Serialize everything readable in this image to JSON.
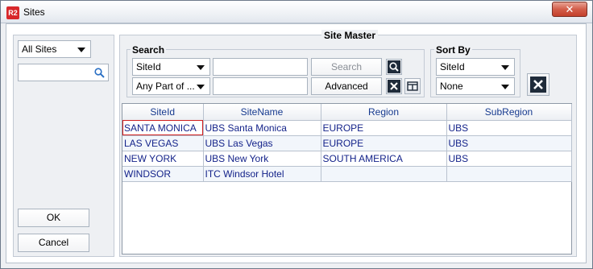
{
  "window": {
    "app_icon": "R2",
    "title": "Sites",
    "close_glyph": "✕"
  },
  "left": {
    "site_filter": "All Sites",
    "search_placeholder": "",
    "ok_label": "OK",
    "cancel_label": "Cancel"
  },
  "main": {
    "title": "Site Master",
    "search": {
      "group_label": "Search",
      "field_select": "SiteId",
      "field_value": "",
      "match_select": "Any Part of ...",
      "match_value": "",
      "search_label": "Search",
      "advanced_label": "Advanced"
    },
    "sort": {
      "group_label": "Sort By",
      "primary": "SiteId",
      "secondary": "None"
    }
  },
  "grid": {
    "columns": [
      "SiteId",
      "SiteName",
      "Region",
      "SubRegion"
    ],
    "rows": [
      [
        "SANTA MONICA",
        "UBS Santa Monica",
        "EUROPE",
        "UBS"
      ],
      [
        "LAS VEGAS",
        "UBS Las Vegas",
        "EUROPE",
        "UBS"
      ],
      [
        "NEW YORK",
        "UBS New York",
        "SOUTH AMERICA",
        "UBS"
      ],
      [
        "WINDSOR",
        "ITC Windsor Hotel",
        "",
        ""
      ]
    ]
  }
}
